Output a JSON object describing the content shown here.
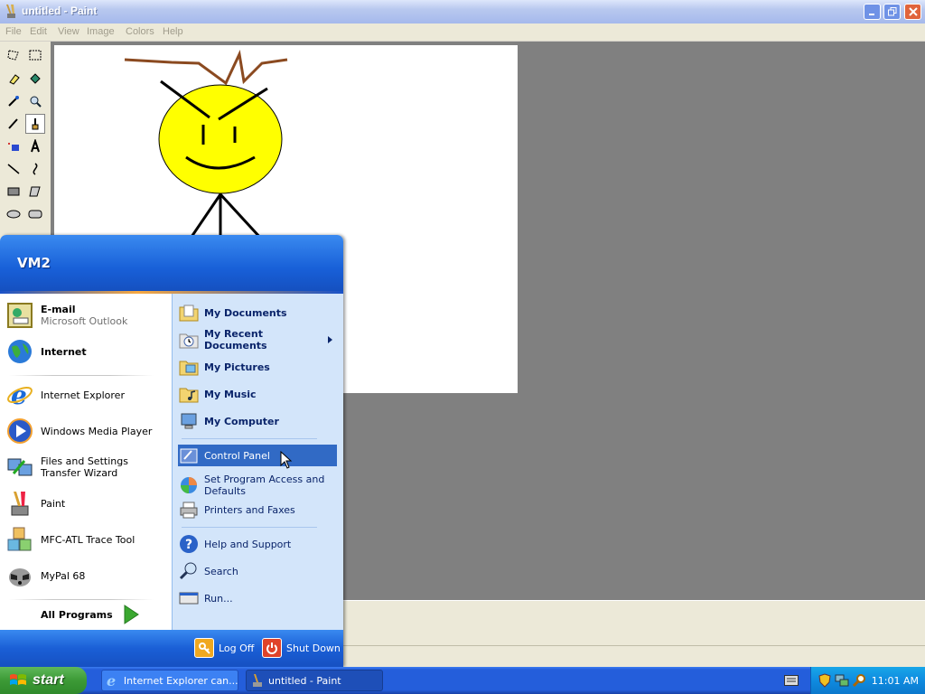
{
  "window": {
    "title": "untitled - Paint"
  },
  "menubar": {
    "items": [
      "File",
      "Edit",
      "View",
      "Image",
      "Colors",
      "Help"
    ]
  },
  "start_menu": {
    "user": "VM2",
    "pinned": [
      {
        "title": "E-mail",
        "subtitle": "Microsoft Outlook"
      },
      {
        "title": "Internet"
      }
    ],
    "recent": [
      "Internet Explorer",
      "Windows Media Player",
      "Files and Settings Transfer Wizard",
      "Paint",
      "MFC-ATL Trace Tool",
      "MyPal 68"
    ],
    "all_programs": "All Programs",
    "right": {
      "my_documents": "My Documents",
      "my_recent_documents": "My Recent Documents",
      "my_pictures": "My Pictures",
      "my_music": "My Music",
      "my_computer": "My Computer",
      "control_panel": "Control Panel",
      "set_program_access": "Set Program Access and Defaults",
      "printers": "Printers and Faxes",
      "help": "Help and Support",
      "search": "Search",
      "run": "Run..."
    },
    "footer": {
      "log_off": "Log Off",
      "shut_down": "Shut Down"
    }
  },
  "taskbar": {
    "start": "start",
    "tasks": [
      "Internet Explorer can...",
      "untitled - Paint"
    ],
    "clock": "11:01 AM"
  }
}
